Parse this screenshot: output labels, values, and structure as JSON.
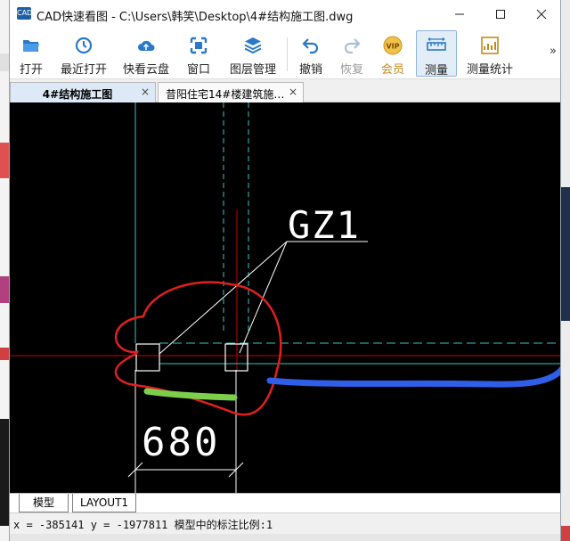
{
  "window": {
    "title": "CAD快速看图 - C:\\Users\\韩笑\\Desktop\\4#结构施工图.dwg",
    "icon_text": "CAD"
  },
  "toolbar": {
    "items": [
      {
        "id": "open",
        "label": "打开",
        "icon": "folder-open-icon"
      },
      {
        "id": "recent",
        "label": "最近打开",
        "icon": "history-clock-icon"
      },
      {
        "id": "cloud",
        "label": "快看云盘",
        "icon": "cloud-icon"
      },
      {
        "id": "window",
        "label": "窗口",
        "icon": "window-icon"
      },
      {
        "id": "layers",
        "label": "图层管理",
        "icon": "layers-icon"
      },
      {
        "id": "undo",
        "label": "撤销",
        "icon": "undo-icon"
      },
      {
        "id": "redo",
        "label": "恢复",
        "icon": "redo-icon"
      },
      {
        "id": "vip",
        "label": "会员",
        "icon": "vip-badge-icon",
        "badge": "VIP"
      },
      {
        "id": "measure",
        "label": "测量",
        "icon": "ruler-icon"
      },
      {
        "id": "measure_stats",
        "label": "测量统计",
        "icon": "measure-stats-icon"
      }
    ],
    "more": "»"
  },
  "tabs": [
    {
      "label": "4#结构施工图",
      "close": "×",
      "active": true
    },
    {
      "label": "昔阳住宅14#楼建筑施…",
      "close": "×",
      "active": false
    }
  ],
  "drawing": {
    "label_gz1": "GZ1",
    "dim_value": "680"
  },
  "layout_tabs": [
    "模型",
    "LAYOUT1"
  ],
  "status": {
    "coords": "x = -385141 y = -1977811 模型中的标注比例:1"
  },
  "colors": {
    "accent": "#1f5fa8",
    "cyan_line": "#37c6c6",
    "red_line": "#c80000",
    "annotation_red": "#e02020",
    "annotation_blue": "#2f5fe8",
    "annotation_green": "#7ccf4a"
  }
}
